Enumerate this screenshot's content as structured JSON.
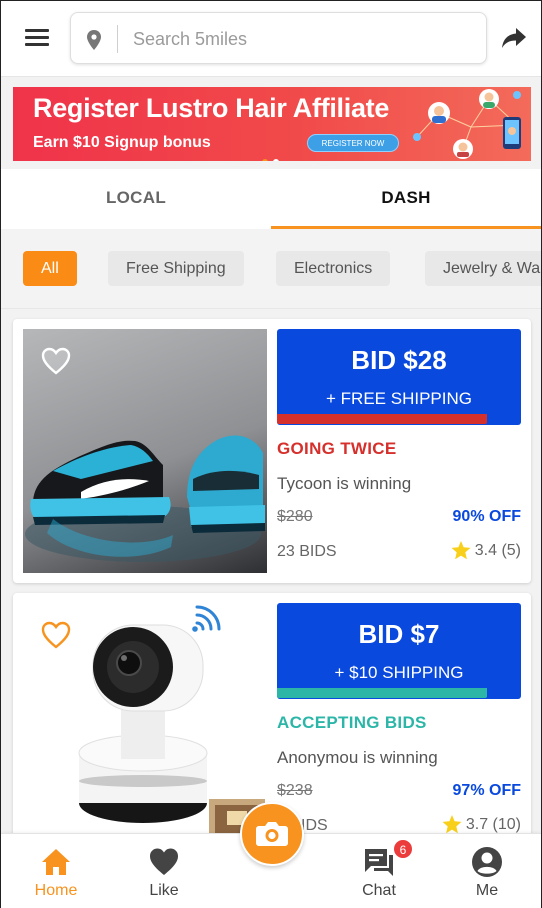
{
  "header": {
    "search_placeholder": "Search 5miles",
    "icons": [
      "menu-icon",
      "location-pin-icon",
      "share-arrow-icon"
    ]
  },
  "banner": {
    "title": "Register Lustro Hair Affiliate",
    "subtitle": "Earn $10 Signup bonus",
    "cta": "REGISTER NOW",
    "background": "#f0334a",
    "dot_count": 2
  },
  "tabs": [
    {
      "label": "LOCAL",
      "active": false
    },
    {
      "label": "DASH",
      "active": true
    }
  ],
  "accent_color": "#f7931e",
  "filters": [
    {
      "label": "All",
      "active": true
    },
    {
      "label": "Free Shipping",
      "active": false
    },
    {
      "label": "Electronics",
      "active": false
    },
    {
      "label": "Jewelry & Wa",
      "active": false
    }
  ],
  "listings": [
    {
      "image": "sneaker-photo",
      "bid": "BID $28",
      "shipping": "+ FREE SHIPPING",
      "progress": 0.86,
      "progress_color": "#d6302c",
      "status": "GOING TWICE",
      "status_color": "#d6302c",
      "winner": "Tycoon is winning",
      "original_price": "$280",
      "discount": "90% OFF",
      "bids": "23 BIDS",
      "rating": "3.4 (5)"
    },
    {
      "image": "wifi-camera-photo",
      "bid": "BID $7",
      "shipping": "+ $10 SHIPPING",
      "progress": 0.86,
      "progress_color": "#2bb6a8",
      "status": "ACCEPTING BIDS",
      "status_color": "#2bb6a8",
      "winner": "Anonymou is winning",
      "original_price": "$238",
      "discount": "97% OFF",
      "bids": "6 BIDS",
      "rating": "3.7 (10)"
    }
  ],
  "bottom_nav": [
    {
      "label": "Home",
      "icon": "home-icon",
      "active": true
    },
    {
      "label": "Like",
      "icon": "heart-icon",
      "active": false
    },
    {
      "label": "",
      "icon": "camera-icon",
      "active": false
    },
    {
      "label": "Chat",
      "icon": "chat-icon",
      "active": false,
      "badge": "6"
    },
    {
      "label": "Me",
      "icon": "user-icon",
      "active": false
    }
  ]
}
